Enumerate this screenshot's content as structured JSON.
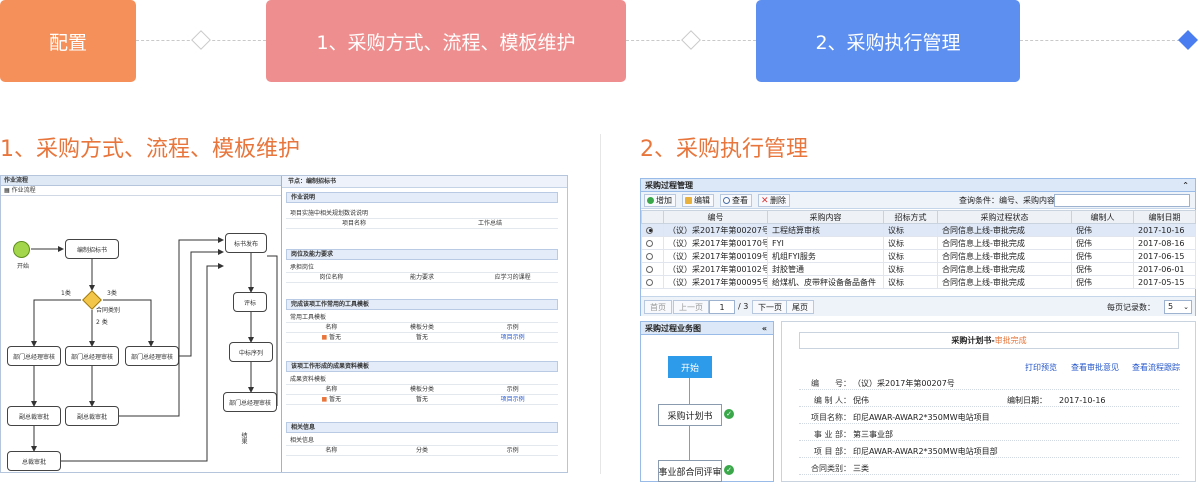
{
  "steps": [
    {
      "label": "配置",
      "color": "#f5905a"
    },
    {
      "label": "1、采购方式、流程、模板维护",
      "color": "#ef8e8e"
    },
    {
      "label": "2、采购执行管理",
      "color": "#5c8ff0"
    }
  ],
  "sections": {
    "left_title": "1、采购方式、流程、模板维护",
    "right_title": "2、采购执行管理"
  },
  "left_panel": {
    "header": "作业流程",
    "toolbar": "作业流程",
    "flow": {
      "start": "开始",
      "bianzhi": "编制招标书",
      "gateway": "合同类别",
      "branch1": "1类",
      "branch3": "3类",
      "side": "2 类",
      "dept1": "部门总经理审核",
      "dept2": "部门总经理审核",
      "dept3": "部门总经理审核",
      "vice1": "副总裁审批",
      "vice2": "副总裁审批",
      "ceo": "总裁审批",
      "fabu": "标书发布",
      "pingbiao": "评标",
      "zhongbiao": "中标序列",
      "dept4": "部门总经理审核",
      "jieguo": "结果"
    },
    "form": {
      "title": "节点：编制招标书",
      "sec1": {
        "head": "作业说明",
        "row": "项目实施中相关规划数说说明",
        "c1": "项目名称",
        "c2": "工作总结"
      },
      "sec2": {
        "head": "岗位及能力要求",
        "row": "承担岗位",
        "c1": "岗位名称",
        "c2": "能力要求",
        "c3": "应学习的课程"
      },
      "sec3": {
        "head": "完成该项工作常用的工具模板",
        "row": "常用工具模板",
        "c1": "名称",
        "c2": "模板分类",
        "c3": "示例",
        "v1": "暂无",
        "v2": "暂无",
        "v3": "项目示例"
      },
      "sec4": {
        "head": "该项工作形成的成果资料模板",
        "row": "成果资料模板",
        "c1": "名称",
        "c2": "模板分类",
        "c3": "示例",
        "v1": "暂无",
        "v2": "暂无",
        "v3": "项目示例"
      },
      "sec5": {
        "head": "相关信息",
        "row": "相关信息",
        "c1": "名称",
        "c2": "分类",
        "c3": "示例"
      }
    }
  },
  "right_panel": {
    "window_title": "采购过程管理",
    "toolbar": {
      "add": "增加",
      "edit": "编辑",
      "view": "查看",
      "delete": "删除",
      "query_label": "查询条件：编号、采购内容"
    },
    "columns": [
      "",
      "编号",
      "采购内容",
      "招标方式",
      "采购过程状态",
      "编制人",
      "编制日期"
    ],
    "rows": [
      {
        "no": "（议）采2017年第00207号",
        "content": "工程结算审核",
        "method": "议标",
        "status": "合同信息上线-审批完成",
        "author": "倪伟",
        "date": "2017-10-16",
        "selected": true
      },
      {
        "no": "（议）采2017年第00170号",
        "content": "FYI",
        "method": "议标",
        "status": "合同信息上线-审批完成",
        "author": "倪伟",
        "date": "2017-08-16",
        "selected": false
      },
      {
        "no": "（议）采2017年第00109号",
        "content": "机组FYI服务",
        "method": "议标",
        "status": "合同信息上线-审批完成",
        "author": "倪伟",
        "date": "2017-06-15",
        "selected": false
      },
      {
        "no": "（议）采2017年第00102号",
        "content": "封胶管通",
        "method": "议标",
        "status": "合同信息上线-审批完成",
        "author": "倪伟",
        "date": "2017-06-01",
        "selected": false
      },
      {
        "no": "（议）采2017年第00095号",
        "content": "给煤机、皮带秤设备备品备件",
        "method": "议标",
        "status": "合同信息上线-审批完成",
        "author": "倪伟",
        "date": "2017-05-15",
        "selected": false
      }
    ],
    "pager": {
      "first": "首页",
      "prev": "上一页",
      "page": "1",
      "total": "/ 3",
      "next": "下一页",
      "last": "尾页",
      "per_page_label": "每页记录数：",
      "per_page": "5"
    },
    "flow_window": {
      "title": "采购过程业务图",
      "start": "开始",
      "node1": "采购计划书",
      "node2": "事业部合同评审"
    },
    "doc": {
      "title": "采购计划书-",
      "status": "审批完成",
      "links": [
        "打印预览",
        "查看审批意见",
        "查看流程跟踪"
      ],
      "fields": [
        {
          "k": "编　　号：",
          "v": "（议）采2017年第00207号"
        },
        {
          "k": "编 制 人：",
          "v": "倪伟",
          "k2": "编制日期：",
          "v2": "2017-10-16"
        },
        {
          "k": "项目名称：",
          "v": "印尼AWAR-AWAR2*350MW电站项目"
        },
        {
          "k": "事 业 部：",
          "v": "第三事业部"
        },
        {
          "k": "项 目 部：",
          "v": "印尼AWAR-AWAR2*350MW电站项目部"
        },
        {
          "k": "合同类别：",
          "v": "三类"
        }
      ]
    }
  }
}
